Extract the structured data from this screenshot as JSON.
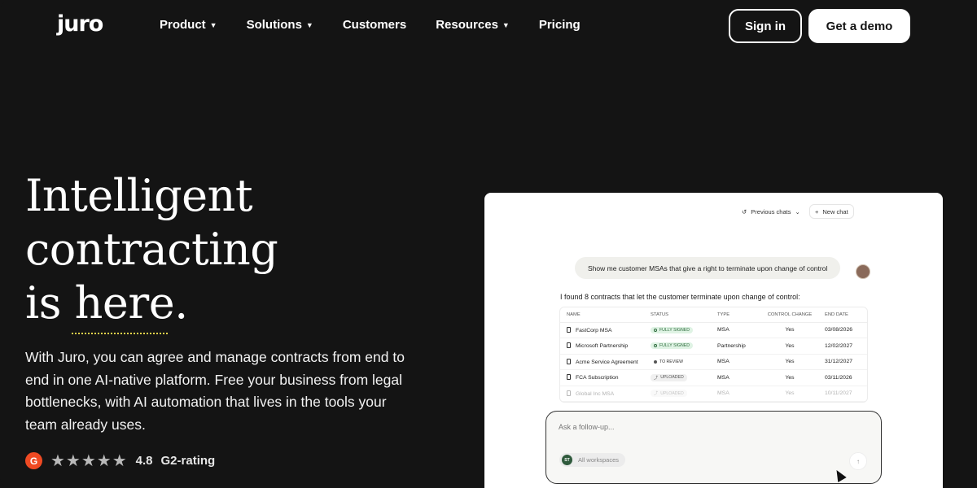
{
  "header": {
    "logo": "juro",
    "nav": [
      {
        "label": "Product",
        "caret": true
      },
      {
        "label": "Solutions",
        "caret": true
      },
      {
        "label": "Customers",
        "caret": false
      },
      {
        "label": "Resources",
        "caret": true
      },
      {
        "label": "Pricing",
        "caret": false
      }
    ],
    "sign_in": "Sign in",
    "get_demo": "Get a demo"
  },
  "hero": {
    "title_lines": [
      "Intelligent",
      "contracting",
      "is here."
    ],
    "subtitle": "With Juro, you can agree and manage contracts from end to end in one AI-native platform. Free your business from legal bottlenecks, with AI automation that lives in the tools your team already uses.",
    "rating": {
      "badge": "G",
      "stars": "★★★★★",
      "score": "4.8",
      "label": "G2-rating"
    }
  },
  "panel": {
    "previous_chats": "Previous chats",
    "new_chat": "New chat",
    "user_message": "Show me customer MSAs that give a right to terminate upon change of control",
    "reply": "I found 8 contracts that let the customer terminate upon change of control:",
    "table": {
      "headers": [
        "NAME",
        "STATUS",
        "TYPE",
        "CONTROL CHANGE",
        "END DATE"
      ],
      "rows": [
        {
          "name": "FastCorp MSA",
          "status": "FULLY SIGNED",
          "status_kind": "signed",
          "type": "MSA",
          "control": "Yes",
          "end": "03/08/2026"
        },
        {
          "name": "Microsoft Partnership",
          "status": "FULLY SIGNED",
          "status_kind": "signed",
          "type": "Partnership",
          "control": "Yes",
          "end": "12/02/2027"
        },
        {
          "name": "Acme Service Agreement",
          "status": "TO REVIEW",
          "status_kind": "review",
          "type": "MSA",
          "control": "Yes",
          "end": "31/12/2027"
        },
        {
          "name": "FCA Subscription",
          "status": "UPLOADED",
          "status_kind": "uploaded",
          "type": "MSA",
          "control": "Yes",
          "end": "03/11/2026"
        },
        {
          "name": "Global Inc MSA",
          "status": "UPLOADED",
          "status_kind": "uploaded",
          "type": "MSA",
          "control": "Yes",
          "end": "10/11/2027"
        }
      ]
    },
    "followup_placeholder": "Ask a follow-up...",
    "workspace_badge": "ST",
    "workspace_label": "All workspaces"
  },
  "colors": {
    "background": "#141414",
    "accent_underline": "#e8d24a",
    "g2_brand": "#ef4a23",
    "signed_bg": "#dff3e4"
  }
}
